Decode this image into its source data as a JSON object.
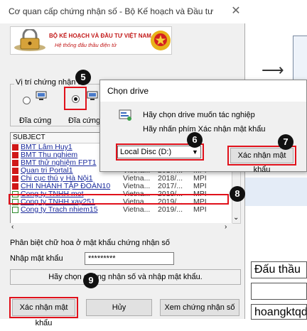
{
  "main_dialog": {
    "title": "Cơ quan cấp chứng nhận số - Bộ Kế hoạch và Đầu tư",
    "banner_line1": "BỘ KẾ HOẠCH VÀ ĐẦU TƯ VIỆT NAM",
    "banner_line2": "Hệ thống đấu thầu điện tử",
    "location_group_label": "Vị trí chứng nhận số",
    "radio_labels": [
      "Đĩa cứng",
      "Đĩa cứng x"
    ],
    "list": {
      "header_subject": "SUBJECT",
      "rows": [
        {
          "subject": "BMT Lâm Huy1",
          "c2": "",
          "c3": "",
          "c4": "",
          "icon": "red"
        },
        {
          "subject": "BMT Thu nghiem",
          "c2": "",
          "c3": "",
          "c4": "",
          "icon": "red"
        },
        {
          "subject": "BMT thử nghiệm FPT1",
          "c2": "",
          "c3": "",
          "c4": "",
          "icon": "red"
        },
        {
          "subject": "Quan tri Portal1",
          "c2": "Vietna...",
          "c3": "2017/...",
          "c4": "MPI",
          "icon": "red"
        },
        {
          "subject": "Chi cục thú y Hà Nội1",
          "c2": "Vietna...",
          "c3": "2018/...",
          "c4": "MPI",
          "icon": "red"
        },
        {
          "subject": "CHI NHÁNH TẬP ĐOÀN10",
          "c2": "Vietna...",
          "c3": "2017/...",
          "c4": "MPI",
          "icon": "red"
        },
        {
          "subject": "Cong ty TNHH mot",
          "c2": "Vietna...",
          "c3": "2019/...",
          "c4": "MPI",
          "icon": "green"
        },
        {
          "subject": "Cong ty TNHH xay251",
          "c2": "Vietna...",
          "c3": "2019/...",
          "c4": "MPI",
          "icon": "green"
        },
        {
          "subject": "Cong ty Trach nhiem15",
          "c2": "Vietna...",
          "c3": "2019/...",
          "c4": "MPI",
          "icon": "green"
        }
      ]
    },
    "case_note": "Phân biệt chữ hoa ở mật khẩu chứng nhận số",
    "password_label": "Nhập mật khẩu",
    "password_value": "*********",
    "status_message": "Hãy chọn chứng nhận số và nhập mật khẩu.",
    "confirm_button": "Xác nhận mật khẩu",
    "cancel_button": "Hủy",
    "view_cert_button": "Xem chứng nhận số"
  },
  "drive_dialog": {
    "title": "Chọn drive",
    "instruction1": "Hãy chọn drive muốn tác nghiệp",
    "instruction2": "Hãy nhấn phím Xác nhận mật khẩu",
    "drive_selected": "Local Disc (D:)",
    "confirm_button": "Xác nhận mật khẩu"
  },
  "step_badges": [
    "5",
    "6",
    "7",
    "8",
    "9"
  ],
  "background_app": {
    "field1": "Đấu thầu",
    "field2": "",
    "field3": "hoangktqd9"
  },
  "colors": {
    "highlight": "#e0111b",
    "badge": "#111111",
    "link": "#1a2a9c"
  }
}
